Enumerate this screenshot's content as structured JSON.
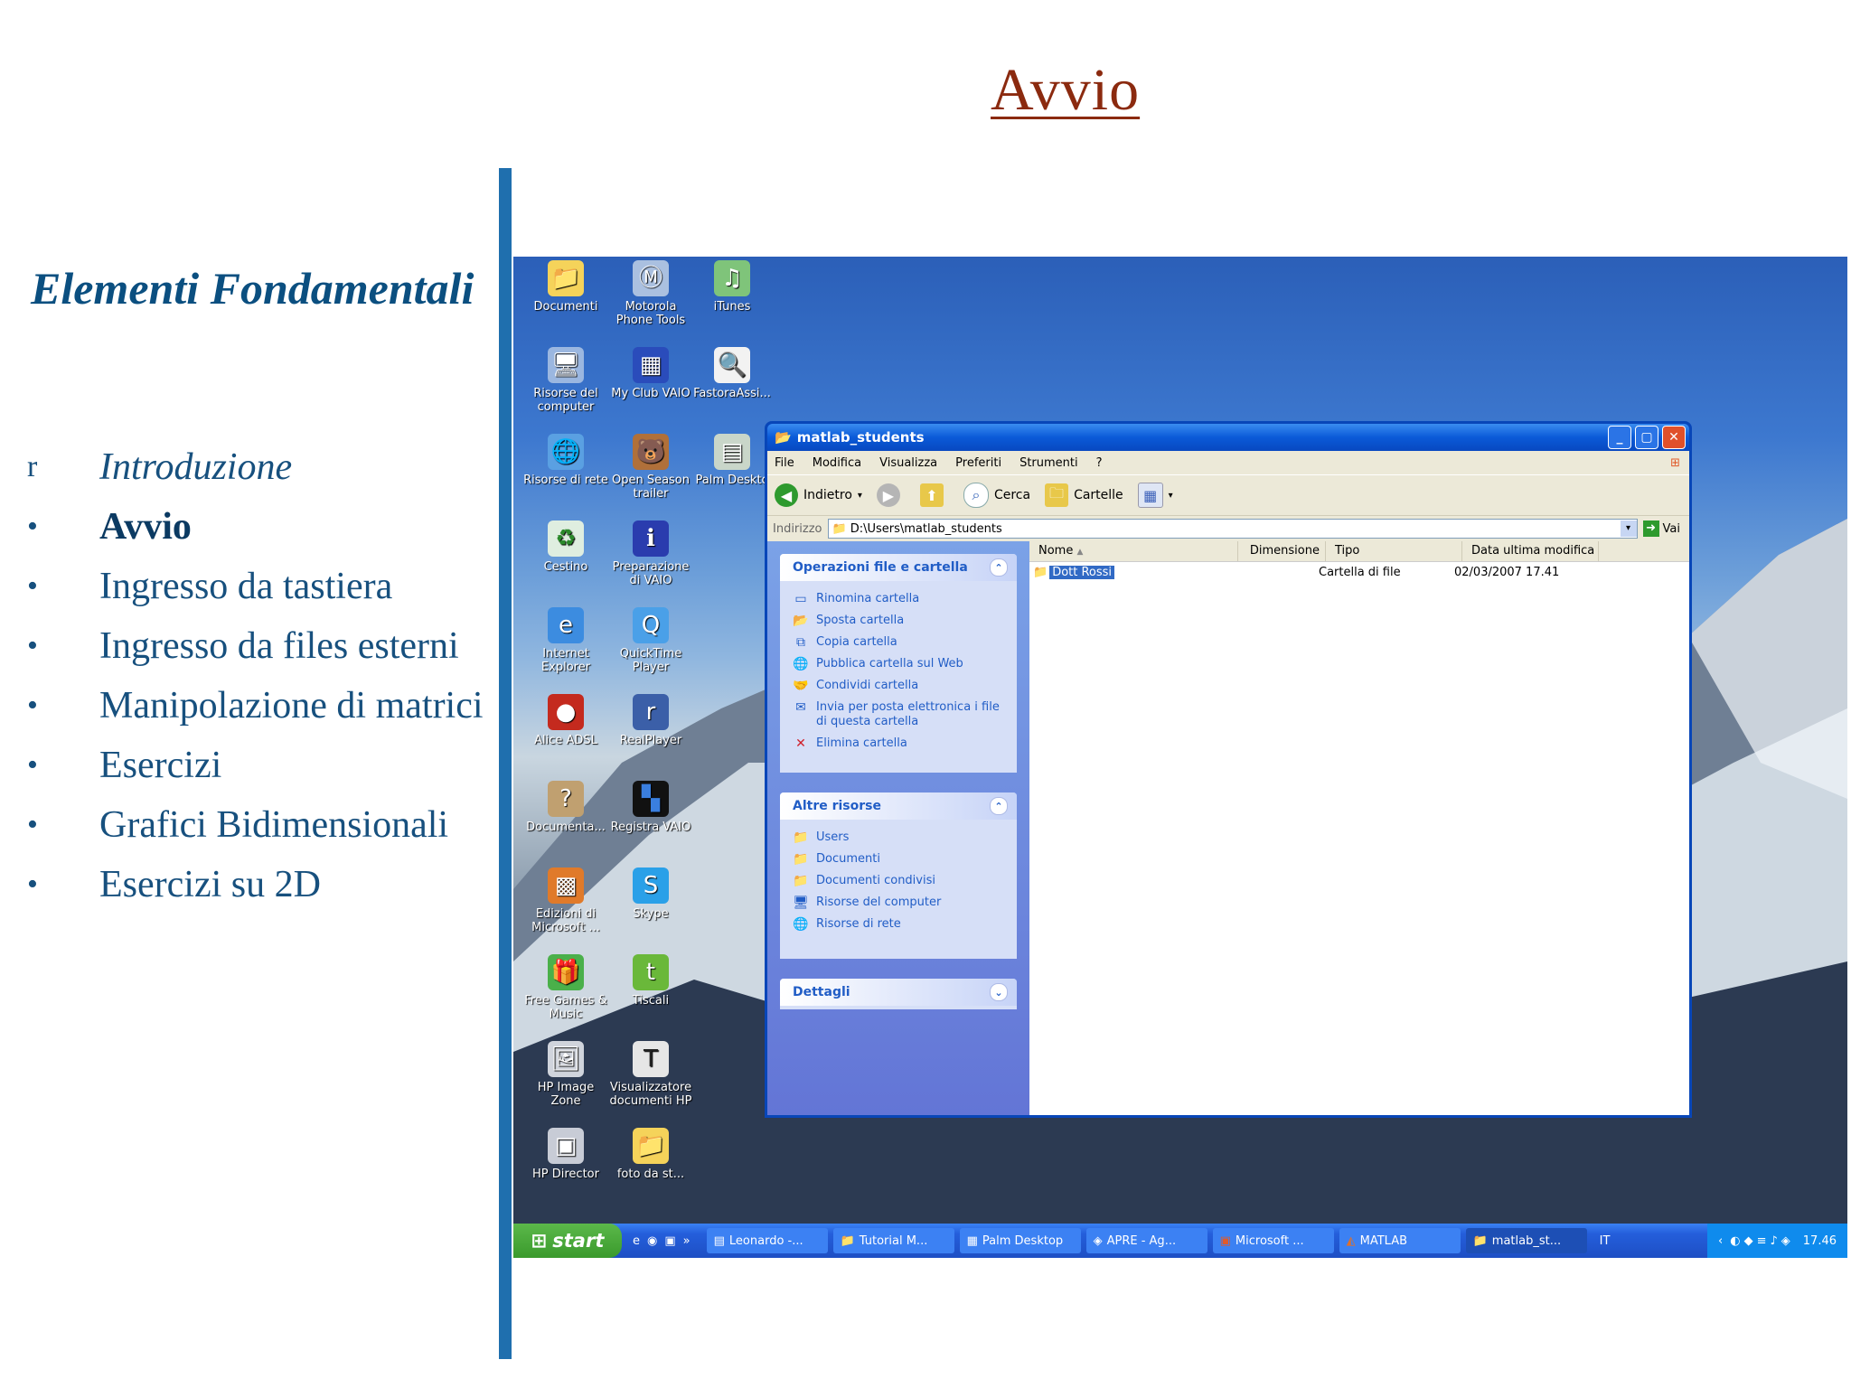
{
  "slide": {
    "title": "Avvio",
    "section": "Elementi Fondamentali",
    "bullets": [
      {
        "marker": "r",
        "text": "Introduzione",
        "style": "italic"
      },
      {
        "marker": "•",
        "text": "Avvio",
        "style": "bold"
      },
      {
        "marker": "•",
        "text": "Ingresso da tastiera",
        "style": "normal"
      },
      {
        "marker": "•",
        "text": "Ingresso da files esterni",
        "style": "normal"
      },
      {
        "marker": "•",
        "text": "Manipolazione di matrici",
        "style": "normal"
      },
      {
        "marker": "•",
        "text": "Esercizi",
        "style": "normal"
      },
      {
        "marker": "•",
        "text": "Grafici Bidimensionali",
        "style": "normal"
      },
      {
        "marker": "•",
        "text": "Esercizi su 2D",
        "style": "normal"
      }
    ]
  },
  "desktop": {
    "icons": [
      {
        "label": "Documenti",
        "icon": "folder-documents-icon"
      },
      {
        "label": "Motorola Phone Tools",
        "icon": "motorola-icon"
      },
      {
        "label": "iTunes",
        "icon": "itunes-icon"
      },
      {
        "label": "Risorse del computer",
        "icon": "computer-icon"
      },
      {
        "label": "My Club VAIO",
        "icon": "vaio-icon"
      },
      {
        "label": "FastoraAssi...",
        "icon": "magnifier-icon"
      },
      {
        "label": "Risorse di rete",
        "icon": "network-icon"
      },
      {
        "label": "Open Season trailer",
        "icon": "open-season-icon"
      },
      {
        "label": "Palm Deskto",
        "icon": "palm-icon"
      },
      {
        "label": "Cestino",
        "icon": "recycle-bin-icon"
      },
      {
        "label": "Preparazione di VAIO",
        "icon": "info-icon"
      },
      {
        "label": "Internet Explorer",
        "icon": "internet-explorer-icon"
      },
      {
        "label": "QuickTime Player",
        "icon": "quicktime-icon"
      },
      {
        "label": "Alice ADSL",
        "icon": "alice-icon"
      },
      {
        "label": "RealPlayer",
        "icon": "realplayer-icon"
      },
      {
        "label": "Documenta...",
        "icon": "help-document-icon"
      },
      {
        "label": "Registra VAIO",
        "icon": "registra-vaio-icon"
      },
      {
        "label": "Edizioni di Microsoft ...",
        "icon": "microsoft-icon"
      },
      {
        "label": "Skype",
        "icon": "skype-icon"
      },
      {
        "label": "Free Games & Music",
        "icon": "gift-icon"
      },
      {
        "label": "Tiscali",
        "icon": "tiscali-icon"
      },
      {
        "label": "HP Image Zone",
        "icon": "hp-image-zone-icon"
      },
      {
        "label": "Visualizzatore documenti HP",
        "icon": "hp-viewer-icon"
      },
      {
        "label": "HP Director",
        "icon": "hp-director-icon"
      },
      {
        "label": "foto da st...",
        "icon": "folder-icon"
      }
    ]
  },
  "window": {
    "title": "matlab_students",
    "menu": [
      "File",
      "Modifica",
      "Visualizza",
      "Preferiti",
      "Strumenti",
      "?"
    ],
    "toolbar": {
      "back": "Indietro",
      "search": "Cerca",
      "folders": "Cartelle"
    },
    "address": {
      "label": "Indirizzo",
      "value": "D:\\Users\\matlab_students",
      "go": "Vai"
    },
    "panes": {
      "tasks": {
        "title": "Operazioni file e cartella",
        "items": [
          "Rinomina cartella",
          "Sposta cartella",
          "Copia cartella",
          "Pubblica cartella sul Web",
          "Condividi cartella",
          "Invia per posta elettronica i file di questa cartella",
          "Elimina cartella"
        ]
      },
      "other": {
        "title": "Altre risorse",
        "items": [
          "Users",
          "Documenti",
          "Documenti condivisi",
          "Risorse del computer",
          "Risorse di rete"
        ]
      },
      "details": {
        "title": "Dettagli"
      }
    },
    "columns": [
      "Nome",
      "Dimensione",
      "Tipo",
      "Data ultima modifica"
    ],
    "rows": [
      {
        "name": "Dott Rossi",
        "size": "",
        "type": "Cartella di file",
        "date": "02/03/2007 17.41"
      }
    ]
  },
  "taskbar": {
    "start": "start",
    "tasks": [
      "Leonardo -...",
      "Tutorial M...",
      "Palm Desktop",
      "APRE - Ag...",
      "Microsoft ...",
      "MATLAB",
      "matlab_st..."
    ],
    "lang": "IT",
    "clock": "17.46"
  },
  "colors": {
    "accent": "#1f6fae",
    "title": "#8b2a0f",
    "text": "#17507e"
  }
}
